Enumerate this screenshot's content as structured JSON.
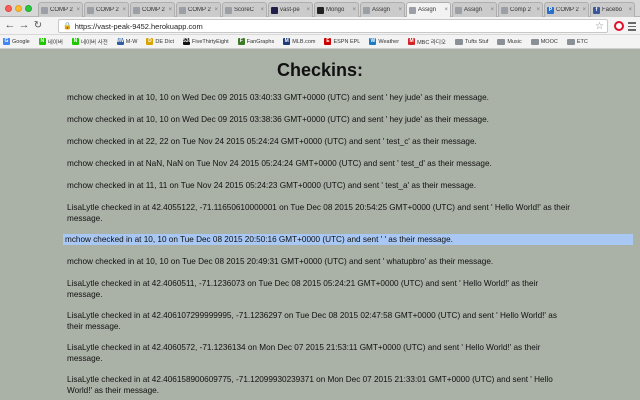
{
  "browser": {
    "tabs": [
      {
        "label": "COMP 2",
        "favicon": "",
        "color": "#9aa0a6"
      },
      {
        "label": "COMP 2",
        "favicon": "",
        "color": "#9aa0a6"
      },
      {
        "label": "COMP 2",
        "favicon": "",
        "color": "#9aa0a6"
      },
      {
        "label": "COMP 2",
        "favicon": "",
        "color": "#9aa0a6"
      },
      {
        "label": "ScoreC",
        "favicon": "",
        "color": "#9aa0a6"
      },
      {
        "label": "vast-pe",
        "favicon": "",
        "color": "#1f1f4a"
      },
      {
        "label": "Mongo",
        "favicon": "",
        "color": "#222222"
      },
      {
        "label": "Assign",
        "favicon": "",
        "color": "#9aa0a6"
      },
      {
        "label": "Assign",
        "favicon": "",
        "color": "#9aa0a6",
        "active": true
      },
      {
        "label": "Assign",
        "favicon": "",
        "color": "#9aa0a6"
      },
      {
        "label": "Comp 2",
        "favicon": "",
        "color": "#9aa0a6"
      },
      {
        "label": "COMP 2",
        "favicon": "P",
        "color": "#2b6ec9"
      },
      {
        "label": "Facebo",
        "favicon": "f",
        "color": "#3b5998"
      }
    ],
    "url": "https://vast-peak-9452.herokuapp.com",
    "bookmarks": [
      {
        "label": "Google",
        "icon": "G",
        "color": "#4285f4"
      },
      {
        "label": "네이버",
        "icon": "N",
        "color": "#1ec800"
      },
      {
        "label": "네이버 사전",
        "icon": "N",
        "color": "#1ec800"
      },
      {
        "label": "M-W",
        "icon": "MW",
        "color": "#2d5d9f"
      },
      {
        "label": "DE Dict",
        "icon": "D",
        "color": "#d9a400"
      },
      {
        "label": "FiveThirtyEight",
        "icon": "538",
        "color": "#111111"
      },
      {
        "label": "FanGraphs",
        "icon": "F",
        "color": "#3d7b2b"
      },
      {
        "label": "MLB.com",
        "icon": "M",
        "color": "#1b3b7a"
      },
      {
        "label": "ESPN EPL",
        "icon": "E",
        "color": "#cc0000"
      },
      {
        "label": "Weather",
        "icon": "W",
        "color": "#1f7bc1"
      },
      {
        "label": "MBC 라디오",
        "icon": "M",
        "color": "#d2232a"
      },
      {
        "label": "Tufts Stuf",
        "folder": true
      },
      {
        "label": "Music",
        "folder": true
      },
      {
        "label": "MOOC",
        "folder": true
      },
      {
        "label": "ETC",
        "folder": true
      }
    ]
  },
  "page": {
    "title": "Checkins:",
    "checkins": [
      {
        "text": "mchow checked in at 10, 10 on Wed Dec 09 2015 03:40:33 GMT+0000 (UTC) and sent ' hey jude' as their message."
      },
      {
        "text": "mchow checked in at 10, 10 on Wed Dec 09 2015 03:38:36 GMT+0000 (UTC) and sent ' hey jude' as their message."
      },
      {
        "text": "mchow checked in at 22, 22 on Tue Nov 24 2015 05:24:24 GMT+0000 (UTC) and sent ' test_c' as their message."
      },
      {
        "text": "mchow checked in at NaN, NaN on Tue Nov 24 2015 05:24:24 GMT+0000 (UTC) and sent ' test_d' as their message."
      },
      {
        "text": "mchow checked in at 11, 11 on Tue Nov 24 2015 05:24:23 GMT+0000 (UTC) and sent ' test_a' as their message."
      },
      {
        "text": "LisaLytle checked in at 42.4055122, -71.11650610000001 on Tue Dec 08 2015 20:54:25 GMT+0000 (UTC) and sent ' Hello World!' as their message."
      },
      {
        "text": "mchow checked in at 10, 10 on Tue Dec 08 2015 20:50:16 GMT+0000 (UTC) and sent ' ' as their message.",
        "selected": true
      },
      {
        "text": "mchow checked in at 10, 10 on Tue Dec 08 2015 20:49:31 GMT+0000 (UTC) and sent ' whatupbro' as their message."
      },
      {
        "text": "LisaLytle checked in at 42.4060511, -71.1236073 on Tue Dec 08 2015 05:24:21 GMT+0000 (UTC) and sent ' Hello World!' as their message."
      },
      {
        "text": "LisaLytle checked in at 42.406107299999995, -71.1236297 on Tue Dec 08 2015 02:47:58 GMT+0000 (UTC) and sent ' Hello World!' as their message."
      },
      {
        "text": "LisaLytle checked in at 42.4060572, -71.1236134 on Mon Dec 07 2015 21:53:11 GMT+0000 (UTC) and sent ' Hello World!' as their message."
      },
      {
        "text": "LisaLytle checked in at 42.406158900609775, -71.12099930239371 on Mon Dec 07 2015 21:33:01 GMT+0000 (UTC) and sent ' Hello World!' as their message."
      }
    ]
  }
}
